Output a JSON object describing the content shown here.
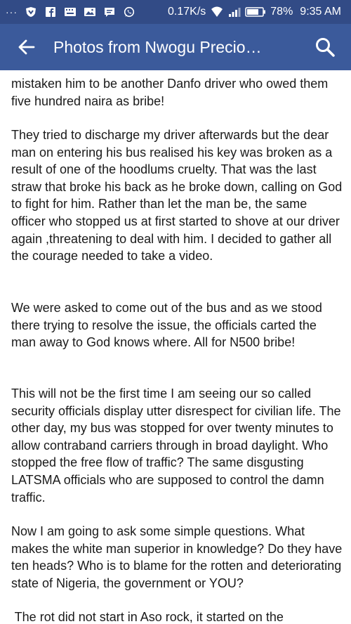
{
  "status": {
    "more": "···",
    "speed": "0.17K/s",
    "battery": "78%",
    "time": "9:35 AM"
  },
  "icons": {
    "notifications": [
      "shield-icon",
      "facebook-icon",
      "keyboard-icon",
      "image-icon",
      "messenger-icon",
      "whatsapp-icon"
    ],
    "status_right": [
      "wifi-icon",
      "signal-icon",
      "battery-icon"
    ],
    "appbar": [
      "back-arrow-icon",
      "search-icon"
    ]
  },
  "colors": {
    "statusbar": "#324b86",
    "appbar": "#3b5a9b",
    "text": "#1a1a1a"
  },
  "appbar": {
    "title": "Photos from Nwogu Precio…"
  },
  "paragraphs": [
    "mistaken him to be another Danfo driver who owed them five hundred naira as bribe!",
    "They tried to discharge my driver afterwards but the dear man on entering his bus realised his key was broken as a result of one of the hoodlums cruelty. That was the last straw that broke his back as he broke down, calling on God to fight for him. Rather than let the man be, the same officer who stopped us at first started to shove at our driver again ,threatening to deal with him. I decided to gather all the courage needed to take a video.",
    "We were asked to come out of the bus and as we stood there trying to resolve the issue, the officials carted the man away to God knows where. All for N500 bribe!",
    "This will not be the first time I am seeing our so called security officials display utter disrespect for civilian life. The other day, my bus was stopped for over twenty minutes to allow contraband carriers through in broad daylight. Who stopped the free flow of traffic? The same disgusting LATSMA officials who are supposed to control the damn traffic.",
    "Now I am going to ask some simple questions. What makes the white man superior in knowledge? Do they have ten heads? Who is to blame for the rotten and deteriorating state of Nigeria, the government or YOU?",
    " The rot did not start in Aso rock, it started on the"
  ]
}
